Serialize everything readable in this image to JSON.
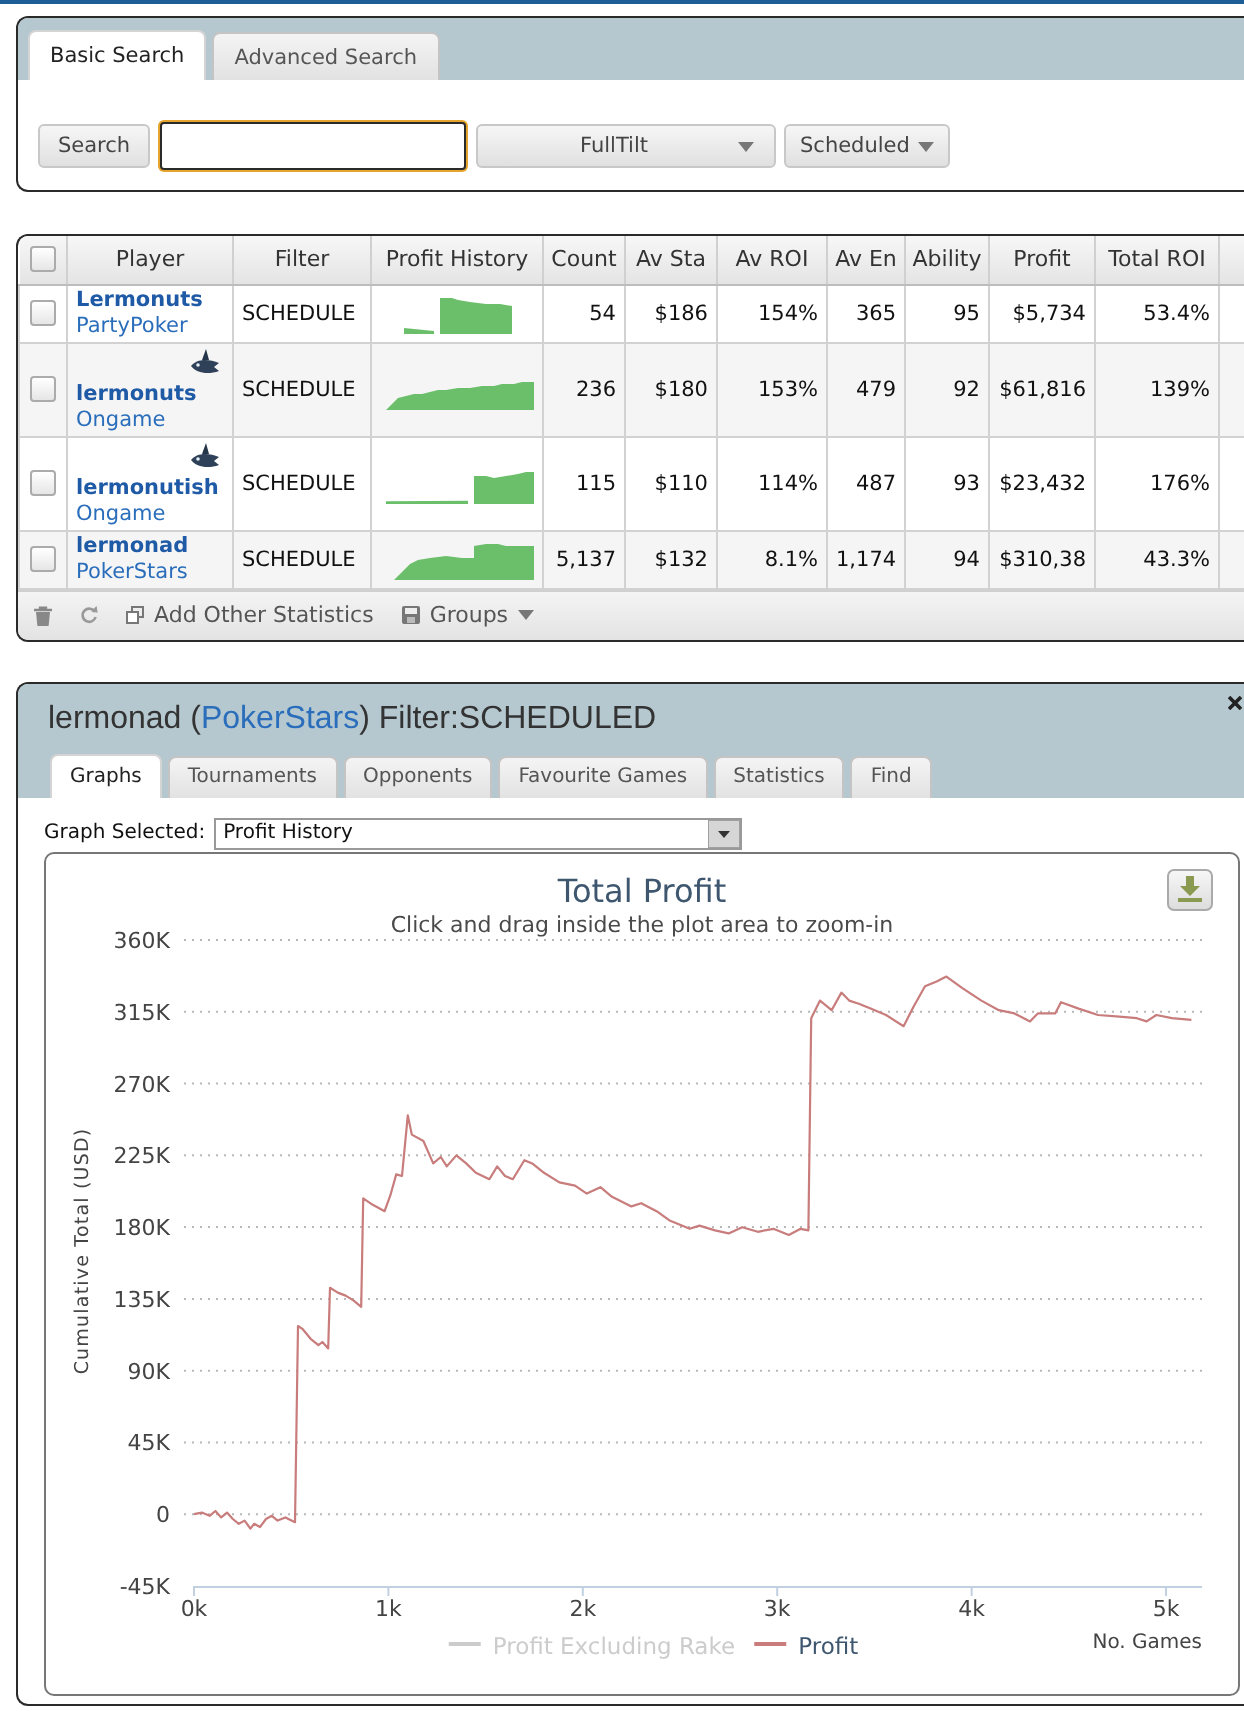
{
  "search_panel": {
    "tabs": [
      {
        "label": "Basic Search",
        "selected": true
      },
      {
        "label": "Advanced Search",
        "selected": false
      }
    ],
    "search_button": "Search",
    "search_field": {
      "focused": true
    },
    "site_dropdown": "FullTilt",
    "status_dropdown": "Scheduled"
  },
  "players_table": {
    "all_selected": false,
    "columns": [
      "Player",
      "Filter",
      "Profit History",
      "Count",
      "Av Sta",
      "Av ROI",
      "Av En",
      "Ability",
      "Profit",
      "Total ROI"
    ],
    "rows": [
      {
        "selected": false,
        "badge": false,
        "player": "Lermonuts",
        "site": "PartyPoker",
        "filter": "SCHEDULE",
        "values": [
          "54",
          "$186",
          "154%",
          "365",
          "95",
          "$5,734",
          "53.4%"
        ]
      },
      {
        "selected": false,
        "badge": true,
        "player": "lermonuts",
        "site": "Ongame",
        "filter": "SCHEDULE",
        "values": [
          "236",
          "$180",
          "153%",
          "479",
          "92",
          "$61,816",
          "139%"
        ]
      },
      {
        "selected": false,
        "badge": true,
        "player": "lermonutish",
        "site": "Ongame",
        "filter": "SCHEDULE",
        "values": [
          "115",
          "$110",
          "114%",
          "487",
          "93",
          "$23,432",
          "176%"
        ]
      },
      {
        "selected": false,
        "badge": false,
        "player": "lermonad",
        "site": "PokerStars",
        "filter": "SCHEDULE",
        "values": [
          "5,137",
          "$132",
          "8.1%",
          "1,174",
          "94",
          "$310,38",
          "43.3%"
        ]
      }
    ],
    "footer": {
      "add_statistics": "Add Other Statistics",
      "groups": "Groups"
    }
  },
  "player_panel": {
    "title_before": "lermonad (",
    "site": "PokerStars",
    "title_after": ") Filter:SCHEDULED",
    "tabs": [
      {
        "label": "Graphs",
        "selected": true
      },
      {
        "label": "Tournaments",
        "selected": false
      },
      {
        "label": "Opponents",
        "selected": false
      },
      {
        "label": "Favourite Games",
        "selected": false
      },
      {
        "label": "Statistics",
        "selected": false
      },
      {
        "label": "Find",
        "selected": false
      }
    ],
    "graph_select": {
      "label": "Graph Selected:",
      "value": "Profit History"
    },
    "graph": {
      "subtitle": "Click and drag inside the plot area to zoom-in",
      "legend": [
        {
          "label": "Profit Excluding Rake",
          "visible": false
        }
      ],
      "chart_data": {
        "type": "line",
        "title": "Total Profit",
        "xlabel": "No. Games",
        "ylabel": "Cumulative Total (USD)",
        "grid": true,
        "x": [
          0,
          40,
          80,
          110,
          140,
          170,
          200,
          230,
          260,
          290,
          310,
          340,
          370,
          400,
          430,
          470,
          520,
          535,
          560,
          600,
          640,
          660,
          690,
          700,
          740,
          780,
          820,
          860,
          870,
          920,
          980,
          1010,
          1040,
          1070,
          1100,
          1120,
          1180,
          1230,
          1270,
          1300,
          1350,
          1400,
          1450,
          1520,
          1560,
          1600,
          1640,
          1700,
          1740,
          1800,
          1880,
          1960,
          2020,
          2090,
          2150,
          2250,
          2300,
          2380,
          2450,
          2550,
          2600,
          2680,
          2750,
          2820,
          2900,
          2980,
          3060,
          3120,
          3160,
          3175,
          3220,
          3280,
          3330,
          3370,
          3420,
          3480,
          3560,
          3650,
          3700,
          3760,
          3820,
          3870,
          3950,
          4050,
          4140,
          4220,
          4300,
          4340,
          4430,
          4460,
          4550,
          4650,
          4760,
          4850,
          4900,
          4950,
          5030,
          5130
        ],
        "series": [
          {
            "name": "Profit",
            "color": "#c87c7c",
            "values": [
              0,
              1000,
              -1000,
              2000,
              -2000,
              1000,
              -3000,
              -6000,
              -4000,
              -9000,
              -6000,
              -8000,
              -3000,
              -1000,
              -4000,
              -2000,
              -5000,
              118000,
              116000,
              110000,
              106000,
              108000,
              104000,
              142000,
              139000,
              137000,
              134000,
              130000,
              198000,
              194000,
              190000,
              200000,
              213000,
              212000,
              250000,
              238000,
              234000,
              220000,
              224000,
              218000,
              225000,
              220000,
              214000,
              210000,
              218000,
              212000,
              210000,
              222000,
              220000,
              214000,
              208000,
              206000,
              201000,
              205000,
              199000,
              193000,
              195000,
              190000,
              184000,
              179000,
              181000,
              178000,
              176000,
              180000,
              177000,
              179000,
              175000,
              179000,
              178000,
              311000,
              322000,
              316000,
              327000,
              322000,
              320000,
              317000,
              313000,
              306000,
              318000,
              331000,
              334000,
              337000,
              330000,
              322000,
              316000,
              314000,
              309000,
              314000,
              314000,
              321000,
              317000,
              313000,
              312000,
              311000,
              309000,
              313000,
              311000,
              310000
            ]
          }
        ],
        "xlim": [
          0,
          5185
        ],
        "ylim": [
          -45000,
          360000
        ],
        "xticks": [
          {
            "value": 0,
            "label": "0k"
          },
          {
            "value": 1000,
            "label": "1k"
          },
          {
            "value": 2000,
            "label": "2k"
          },
          {
            "value": 3000,
            "label": "3k"
          },
          {
            "value": 4000,
            "label": "4k"
          },
          {
            "value": 5000,
            "label": "5k"
          }
        ],
        "yticks": [
          {
            "value": -45000,
            "label": "-45K"
          },
          {
            "value": 0,
            "label": "0"
          },
          {
            "value": 45000,
            "label": "45K"
          },
          {
            "value": 90000,
            "label": "90K"
          },
          {
            "value": 135000,
            "label": "135K"
          },
          {
            "value": 180000,
            "label": "180K"
          },
          {
            "value": 225000,
            "label": "225K"
          },
          {
            "value": 270000,
            "label": "270K"
          },
          {
            "value": 315000,
            "label": "315K"
          },
          {
            "value": 360000,
            "label": "360K"
          }
        ]
      }
    }
  }
}
